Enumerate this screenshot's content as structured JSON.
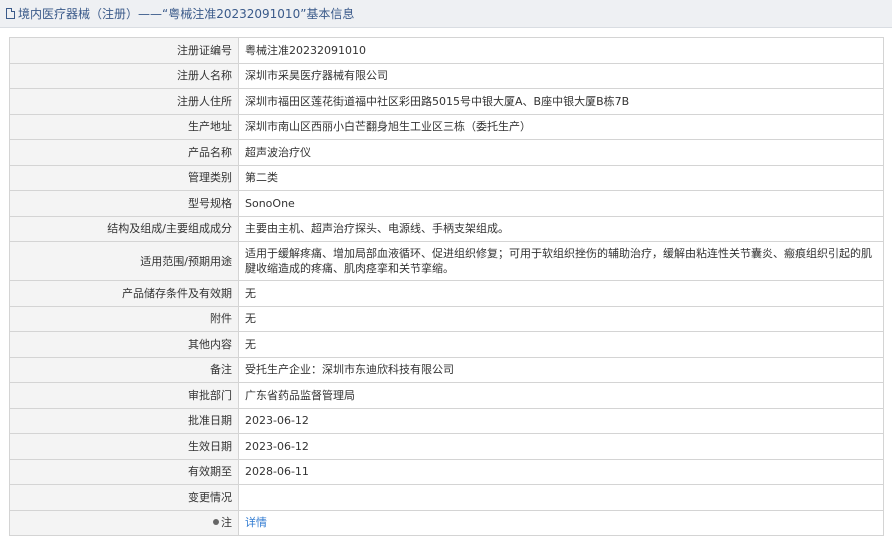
{
  "header": {
    "icon": "document-icon",
    "title": "境内医疗器械（注册）——“粤械注准20232091010”基本信息"
  },
  "rows": [
    {
      "label": "注册证编号",
      "value": "粤械注准20232091010"
    },
    {
      "label": "注册人名称",
      "value": "深圳市采昊医疗器械有限公司"
    },
    {
      "label": "注册人住所",
      "value": "深圳市福田区莲花街道福中社区彩田路5015号中银大厦A、B座中银大厦B栋7B"
    },
    {
      "label": "生产地址",
      "value": "深圳市南山区西丽小白芒翻身旭生工业区三栋（委托生产）"
    },
    {
      "label": "产品名称",
      "value": "超声波治疗仪"
    },
    {
      "label": "管理类别",
      "value": "第二类"
    },
    {
      "label": "型号规格",
      "value": "SonoOne"
    },
    {
      "label": "结构及组成/主要组成成分",
      "value": "主要由主机、超声治疗探头、电源线、手柄支架组成。"
    },
    {
      "label": "适用范围/预期用途",
      "value": "适用于缓解疼痛、增加局部血液循环、促进组织修复；可用于软组织挫伤的辅助治疗，缓解由粘连性关节囊炎、瘢痕组织引起的肌腱收缩造成的疼痛、肌肉痉挛和关节挛缩。"
    },
    {
      "label": "产品储存条件及有效期",
      "value": "无"
    },
    {
      "label": "附件",
      "value": "无"
    },
    {
      "label": "其他内容",
      "value": "无"
    },
    {
      "label": "备注",
      "value": "受托生产企业：深圳市东迪欣科技有限公司"
    },
    {
      "label": "审批部门",
      "value": "广东省药品监督管理局"
    },
    {
      "label": "批准日期",
      "value": "2023-06-12"
    },
    {
      "label": "生效日期",
      "value": "2023-06-12"
    },
    {
      "label": "有效期至",
      "value": "2028-06-11"
    },
    {
      "label": "变更情况",
      "value": ""
    },
    {
      "label": "注",
      "value": "详情",
      "icon": "pin-icon"
    }
  ]
}
